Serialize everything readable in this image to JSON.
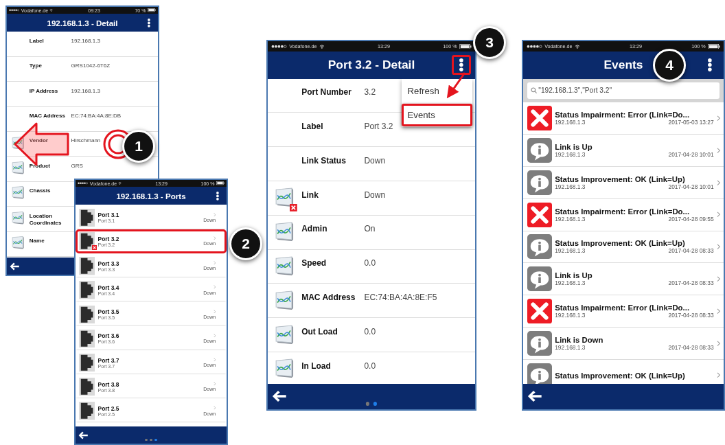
{
  "screens": [
    {
      "kind": "detail",
      "status_bar": {
        "carrier": "Vodafone.de",
        "time": "09:23",
        "battery": "70 %"
      },
      "title": "192.168.1.3 - Detail",
      "menu_button": {
        "highlighted": false
      },
      "rows": [
        {
          "kind": "plain",
          "label": "Label",
          "value": "192.168.1.3"
        },
        {
          "kind": "plain",
          "label": "Type",
          "value": "GRS1042-6T6Z"
        },
        {
          "kind": "plain",
          "label": "IP Address",
          "value": "192.168.1.3"
        },
        {
          "kind": "plain",
          "label": "MAC Address",
          "value": "EC:74:BA:4A:8E:DB"
        },
        {
          "kind": "chart",
          "label": "Vendor",
          "value": "Hirschmann"
        },
        {
          "kind": "chart",
          "label": "Product",
          "value": "GRS"
        },
        {
          "kind": "chart",
          "label": "Chassis"
        },
        {
          "kind": "chart",
          "label": "Location Coordinates"
        },
        {
          "kind": "chart",
          "label": "Name"
        }
      ]
    },
    {
      "kind": "ports",
      "status_bar": {
        "carrier": "Vodafone.de",
        "time": "13:29",
        "battery": "100 %"
      },
      "title": "192.168.1.3 - Ports",
      "menu_button": {
        "highlighted": false
      },
      "ports": [
        {
          "name": "Port 3.1",
          "label": "Port 3.1",
          "status": "Down",
          "error": false,
          "highlighted": false
        },
        {
          "name": "Port 3.2",
          "label": "Port 3.2",
          "status": "Down",
          "error": true,
          "highlighted": true
        },
        {
          "name": "Port 3.3",
          "label": "Port 3.3",
          "status": "Down",
          "error": false,
          "highlighted": false
        },
        {
          "name": "Port 3.4",
          "label": "Port 3.4",
          "status": "Down",
          "error": false,
          "highlighted": false
        },
        {
          "name": "Port 3.5",
          "label": "Port 3.5",
          "status": "Down",
          "error": false,
          "highlighted": false
        },
        {
          "name": "Port 3.6",
          "label": "Port 3.6",
          "status": "Down",
          "error": false,
          "highlighted": false
        },
        {
          "name": "Port 3.7",
          "label": "Port 3.7",
          "status": "Down",
          "error": false,
          "highlighted": false
        },
        {
          "name": "Port 3.8",
          "label": "Port 3.8",
          "status": "Down",
          "error": false,
          "highlighted": false
        },
        {
          "name": "Port 2.5",
          "label": "Port 2.5",
          "status": "Down",
          "error": false,
          "highlighted": false
        }
      ],
      "page_dots": [
        {
          "selected": false
        },
        {
          "selected": false
        },
        {
          "selected": true
        }
      ]
    },
    {
      "kind": "detail",
      "status_bar": {
        "carrier": "Vodafone.de",
        "time": "13:29",
        "battery": "100 %"
      },
      "title": "Port 3.2 - Detail",
      "menu_button": {
        "highlighted": true
      },
      "menu": [
        {
          "label": "Refresh",
          "highlighted": false
        },
        {
          "label": "Events",
          "highlighted": true
        }
      ],
      "rows": [
        {
          "kind": "plain",
          "label": "Port Number",
          "value": "3.2"
        },
        {
          "kind": "plain",
          "label": "Label",
          "value": "Port 3.2"
        },
        {
          "kind": "plain",
          "label": "Link Status",
          "value": "Down"
        },
        {
          "kind": "chart-error",
          "label": "Link",
          "value": "Down"
        },
        {
          "kind": "chart",
          "label": "Admin",
          "value": "On"
        },
        {
          "kind": "chart",
          "label": "Speed",
          "value": "0.0"
        },
        {
          "kind": "chart",
          "label": "MAC Address",
          "value": "EC:74:BA:4A:8E:F5"
        },
        {
          "kind": "chart",
          "label": "Out Load",
          "value": "0.0"
        },
        {
          "kind": "chart",
          "label": "In Load",
          "value": "0.0"
        }
      ],
      "page_dots": [
        {
          "selected": false
        },
        {
          "selected": true
        }
      ]
    },
    {
      "kind": "events",
      "status_bar": {
        "carrier": "Vodafone.de",
        "time": "13:29",
        "battery": "100 %"
      },
      "title": "Events",
      "menu_button": {
        "highlighted": false
      },
      "search": {
        "value": "\"192.168.1.3\",\"Port 3.2\""
      },
      "events": [
        {
          "kind": "error",
          "title": "Status Impairment: Error (Link=Do...",
          "source": "192.168.1.3",
          "time": "2017-05-03 13:27"
        },
        {
          "kind": "info",
          "title": "Link is Up",
          "source": "192.168.1.3",
          "time": "2017-04-28 10:01"
        },
        {
          "kind": "info",
          "title": "Status Improvement: OK (Link=Up)",
          "source": "192.168.1.3",
          "time": "2017-04-28 10:01"
        },
        {
          "kind": "error",
          "title": "Status Impairment: Error (Link=Do...",
          "source": "192.168.1.3",
          "time": "2017-04-28 09:55"
        },
        {
          "kind": "info",
          "title": "Status Improvement: OK (Link=Up)",
          "source": "192.168.1.3",
          "time": "2017-04-28 08:33"
        },
        {
          "kind": "info",
          "title": "Link is Up",
          "source": "192.168.1.3",
          "time": "2017-04-28 08:33"
        },
        {
          "kind": "error",
          "title": "Status Impairment: Error (Link=Do...",
          "source": "192.168.1.3",
          "time": "2017-04-28 08:33"
        },
        {
          "kind": "info",
          "title": "Link is Down",
          "source": "192.168.1.3",
          "time": "2017-04-28 08:33"
        },
        {
          "kind": "info",
          "title": "Status Improvement: OK (Link=Up)"
        }
      ]
    }
  ],
  "annotations": [
    {
      "number": "1"
    },
    {
      "number": "2"
    },
    {
      "number": "3"
    },
    {
      "number": "4"
    }
  ]
}
